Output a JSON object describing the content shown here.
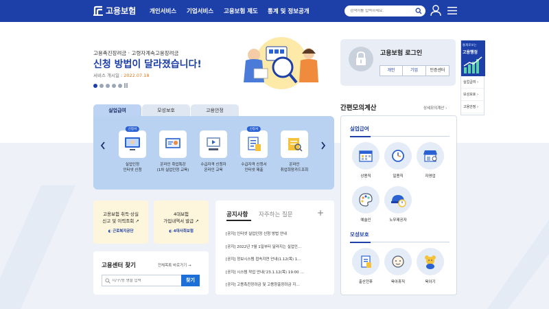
{
  "header": {
    "logo_text": "고용보험",
    "nav": [
      "개인서비스",
      "기업서비스",
      "고용보험 제도",
      "통계 및 정보공개"
    ],
    "search_placeholder": "검색어를 입력하세요."
  },
  "banner": {
    "subtitle": "고용촉진장려금 · 고령자계속고용장려금",
    "title": "신청 방법이 달라졌습니다!",
    "date_label": "서비스 개시일 :",
    "date_value": "2022.07.18",
    "slide_count": 5,
    "active_slide": 1
  },
  "login": {
    "title": "고용보험 로그인",
    "tabs": [
      "개인",
      "기업",
      "인증센터"
    ]
  },
  "quick": {
    "caption": "통계로보는",
    "title": "고용행정",
    "items": [
      "실업급여",
      "모성보호",
      "고용안정"
    ]
  },
  "services": {
    "tabs": [
      "실업급여",
      "모성보호",
      "고용안정"
    ],
    "active_tab": 0,
    "items": [
      {
        "badge": "신청서",
        "line1": "실업인정",
        "line2": "인터넷 신청"
      },
      {
        "badge": "",
        "line1": "온라인 취업특강",
        "line2": "(1차 실업인정 교육)"
      },
      {
        "badge": "",
        "line1": "수급자격 신청자",
        "line2": "온라인 교육"
      },
      {
        "badge": "신청서",
        "line1": "수급자격 신청서",
        "line2": "인터넷 제출"
      },
      {
        "badge": "",
        "line1": "온라인",
        "line2": "취업희망카드조회"
      }
    ]
  },
  "cards": {
    "card1_line1": "고용보험 취득·상실",
    "card1_line2": "신고 및 이력조회",
    "card1_org": "근로복지공단",
    "card2_line1": "4대보험",
    "card2_line2": "가입내역서 발급",
    "card2_org": "4대사회보험"
  },
  "center": {
    "title": "고용센터 찾기",
    "link": "전체목록 바로가기",
    "placeholder": "시/구/동 명을 입력",
    "button": "찾기"
  },
  "notice": {
    "tabs": [
      "공지사항",
      "자주하는 질문"
    ],
    "plus": "+",
    "items": [
      "[공지] 인터넷 실업인정 신청 방법 안내",
      "[공지] 2022년 7월 1일부터 달라지는 실업인…",
      "[공지] 정보시스템 접속지연 안내(1.12(목) 1…",
      "[공지] 시스템 작업 안내('23.1.12(목) 19:00 …",
      "[공지] 고용촉진장려금 및 고용창출장려금 지…"
    ]
  },
  "calc": {
    "title": "간편모의계산",
    "link": "상세모의계산",
    "sec1": "실업급여",
    "sec1_items": [
      "상용직",
      "일용직",
      "자영업",
      "예술인",
      "노무제공자"
    ],
    "sec2": "모성보호",
    "sec2_items": [
      "출산전후",
      "육아휴직",
      "육아기"
    ]
  },
  "colors": {
    "brand": "#1d3fa8",
    "panel": "#b9d2f2",
    "accent_date": "#e8730c"
  }
}
